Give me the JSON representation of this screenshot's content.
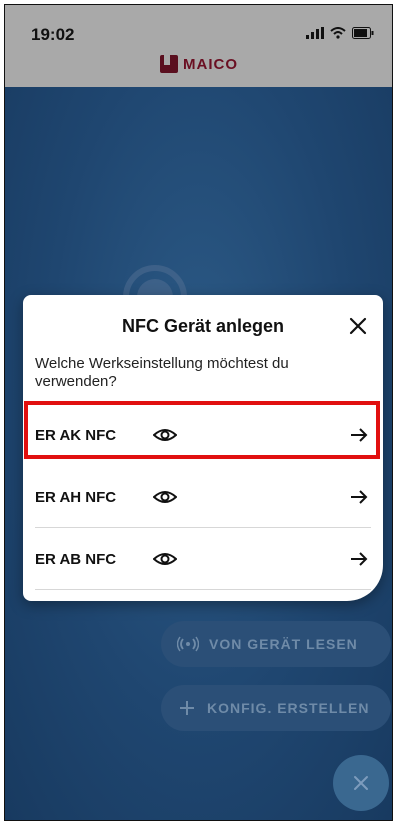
{
  "status_bar": {
    "time": "19:02"
  },
  "header": {
    "brand": "MAICO"
  },
  "dialog": {
    "title": "NFC Gerät anlegen",
    "question": "Welche Werkseinstellung möchtest du verwenden?",
    "options": [
      {
        "label": "ER AK NFC",
        "highlighted": true
      },
      {
        "label": "ER AH NFC",
        "highlighted": false
      },
      {
        "label": "ER AB NFC",
        "highlighted": false
      }
    ]
  },
  "fabs": {
    "read_label": "VON GERÄT LESEN",
    "create_label": "KONFIG. ERSTELLEN"
  },
  "colors": {
    "highlight": "#e10f0f",
    "background": "#1f4670",
    "fab": "#2b4f77",
    "brand": "#6a0f22"
  }
}
